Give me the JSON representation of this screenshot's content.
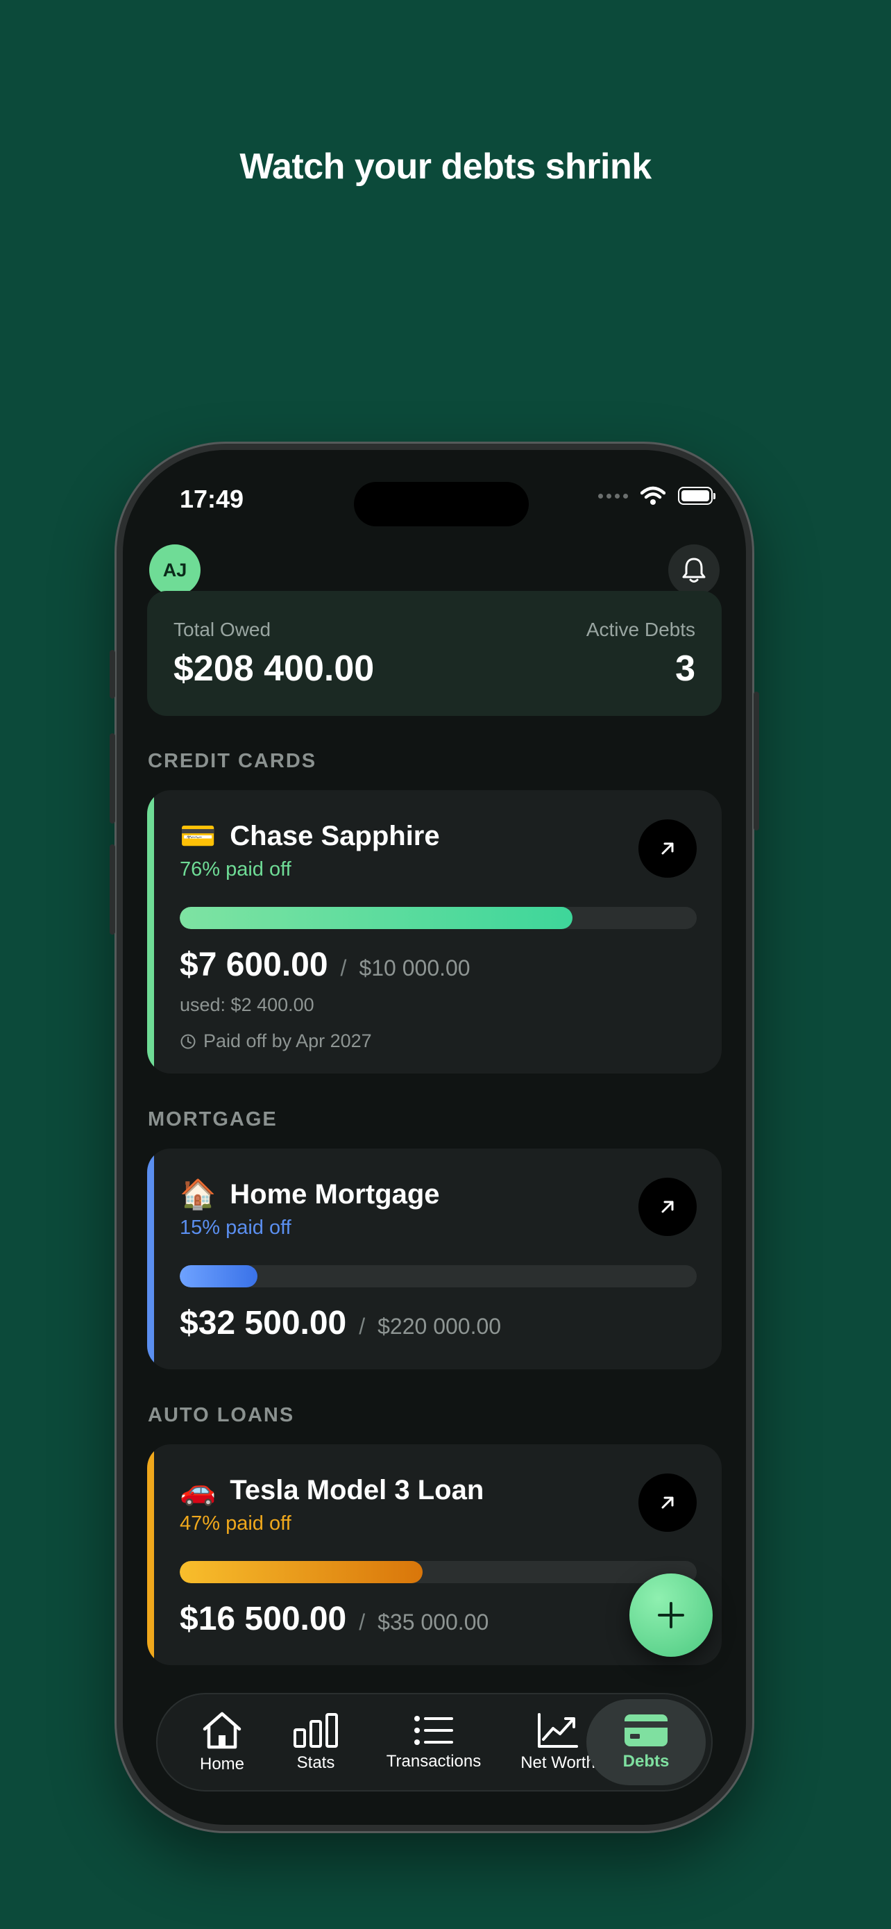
{
  "headline": "Watch your debts shrink",
  "status": {
    "time": "17:49"
  },
  "header": {
    "avatar_initials": "AJ"
  },
  "summary": {
    "total_label": "Total Owed",
    "total_value": "$208 400.00",
    "active_label": "Active Debts",
    "active_value": "3"
  },
  "sections": [
    {
      "label": "CREDIT CARDS",
      "card": {
        "emoji": "💳",
        "title": "Chase Sapphire",
        "pct_label": "76% paid off",
        "progress": 0.76,
        "amount": "$7 600.00",
        "slash": "/",
        "limit": "$10 000.00",
        "used": "used: $2 400.00",
        "payoff": "Paid off by Apr 2027",
        "accent": "#6fdc96"
      }
    },
    {
      "label": "MORTGAGE",
      "card": {
        "emoji": "🏠",
        "title": "Home Mortgage",
        "pct_label": "15% paid off",
        "progress": 0.15,
        "amount": "$32 500.00",
        "slash": "/",
        "limit": "$220 000.00",
        "accent": "#5b8ff0"
      }
    },
    {
      "label": "AUTO LOANS",
      "card": {
        "emoji": "🚗",
        "title": "Tesla Model 3 Loan",
        "pct_label": "47% paid off",
        "progress": 0.47,
        "amount": "$16 500.00",
        "slash": "/",
        "limit": "$35 000.00",
        "accent": "#f0a81c"
      }
    }
  ],
  "tabs": [
    {
      "label": "Home",
      "icon": "home-icon"
    },
    {
      "label": "Stats",
      "icon": "bar-chart-icon"
    },
    {
      "label": "Transactions",
      "icon": "list-icon"
    },
    {
      "label": "Net Worth",
      "icon": "trend-up-icon"
    },
    {
      "label": "Debts",
      "icon": "card-icon",
      "active": true
    }
  ],
  "colors": {
    "background": "#0c4a3a",
    "screen": "#101413",
    "green_accent": "#6fdc96",
    "blue_accent": "#5b8ff0",
    "orange_accent": "#f0a81c"
  }
}
